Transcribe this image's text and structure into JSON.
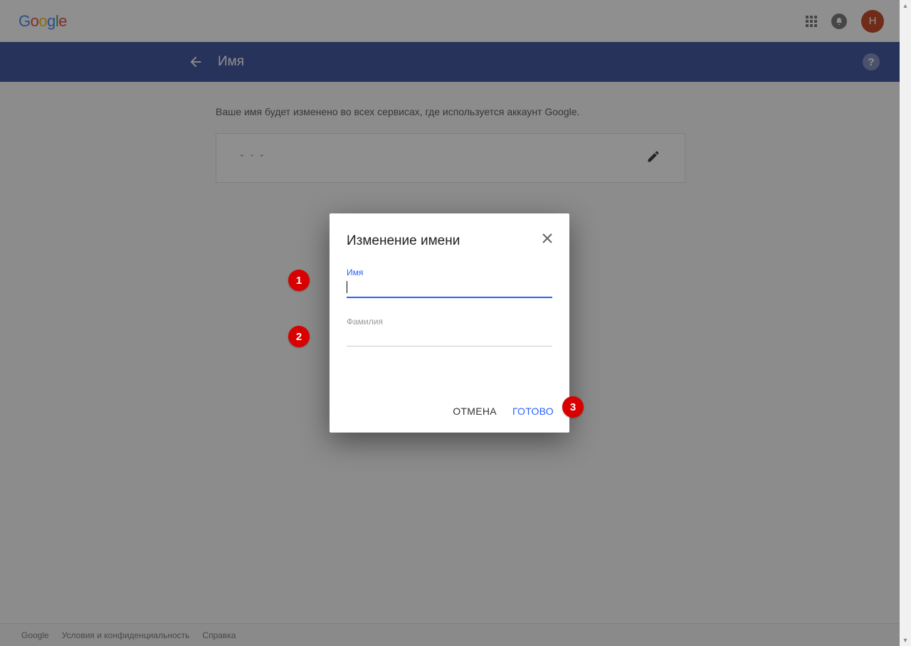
{
  "header": {
    "logo_text": "Google",
    "avatar_initial": "Н"
  },
  "bluebar": {
    "title": "Имя",
    "help_symbol": "?"
  },
  "main": {
    "description": "Ваше имя будет изменено во всех сервисах, где используется аккаунт Google.",
    "current_name_display": "˘  ˇ  ˘"
  },
  "dialog": {
    "title": "Изменение имени",
    "first_name_label": "Имя",
    "first_name_value": "",
    "last_name_label": "Фамилия",
    "last_name_value": "",
    "cancel_label": "ОТМЕНА",
    "done_label": "ГОТОВО"
  },
  "callouts": {
    "c1": "1",
    "c2": "2",
    "c3": "3"
  },
  "footer": {
    "link1": "Google",
    "link2": "Условия и конфиденциальность",
    "link3": "Справка"
  }
}
